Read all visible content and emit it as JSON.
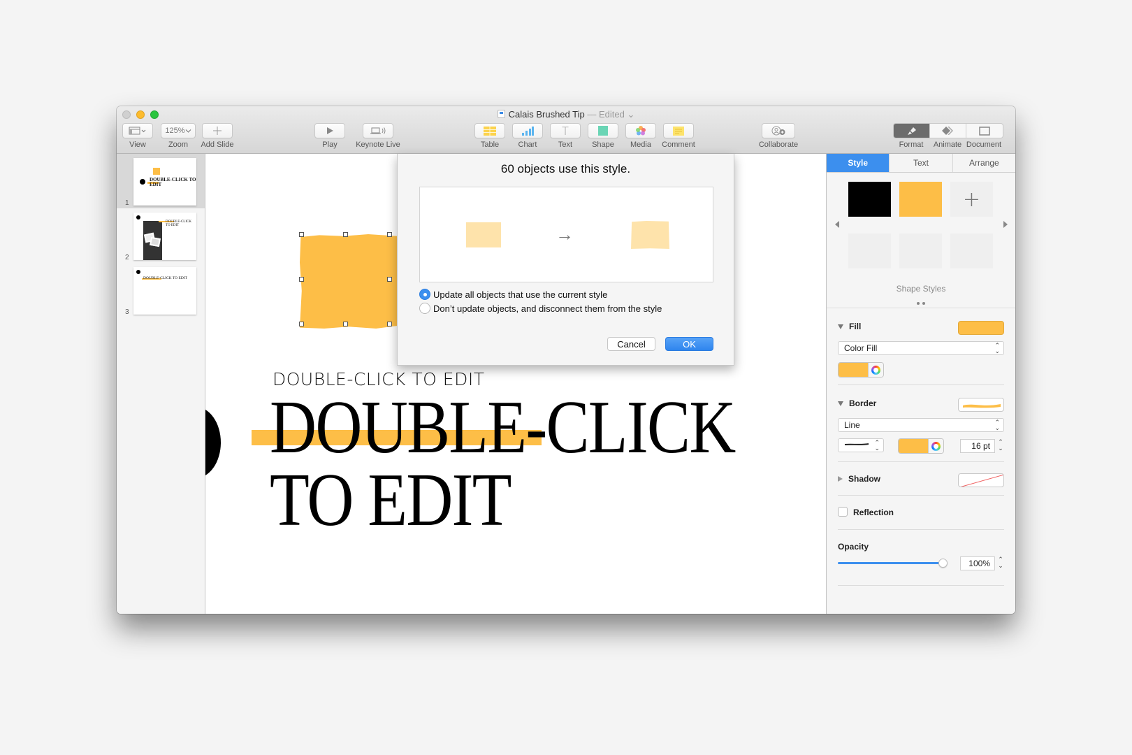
{
  "window": {
    "title": "Calais Brushed Tip",
    "title_separator": " — ",
    "status": "Edited",
    "status_chevron": "⌄"
  },
  "toolbar": {
    "view": {
      "label": "View",
      "icon": "sidebar-layout-icon"
    },
    "zoom": {
      "label": "Zoom",
      "value": "125%"
    },
    "add_slide": {
      "label": "Add Slide",
      "icon": "plus-icon"
    },
    "play": {
      "label": "Play",
      "icon": "play-icon"
    },
    "keynote_live": {
      "label": "Keynote Live",
      "icon": "broadcast-icon"
    },
    "table": {
      "label": "Table",
      "icon": "table-icon"
    },
    "chart": {
      "label": "Chart",
      "icon": "chart-icon"
    },
    "text": {
      "label": "Text",
      "icon": "text-icon",
      "glyph": "T"
    },
    "shape": {
      "label": "Shape",
      "icon": "shape-icon"
    },
    "media": {
      "label": "Media",
      "icon": "photos-icon"
    },
    "comment": {
      "label": "Comment",
      "icon": "comment-icon"
    },
    "collaborate": {
      "label": "Collaborate",
      "icon": "add-person-icon"
    },
    "format": {
      "label": "Format",
      "icon": "paintbrush-icon",
      "active": true
    },
    "animate": {
      "label": "Animate",
      "icon": "diamond-icon"
    },
    "document": {
      "label": "Document",
      "icon": "document-icon"
    }
  },
  "sidebar": {
    "slides": [
      {
        "number": "1",
        "selected": true,
        "heading": "DOUBLE-CLICK TO EDIT"
      },
      {
        "number": "2",
        "selected": false,
        "heading": "DOUBLE-CLICK TO EDIT"
      },
      {
        "number": "3",
        "selected": false,
        "heading": "DOUBLE-CLICK TO EDIT"
      }
    ]
  },
  "canvas": {
    "subtitle": "DOUBLE-CLICK TO EDIT",
    "title_line1": "DOUBLE-CLICK",
    "title_line2": "TO EDIT",
    "accent_color": "#fdbe47"
  },
  "dialog": {
    "title": "60 objects use this style.",
    "arrow": "→",
    "options": [
      {
        "label": "Update all objects that use the current style",
        "selected": true
      },
      {
        "label": "Don’t update objects, and disconnect them from the style",
        "selected": false
      }
    ],
    "cancel_label": "Cancel",
    "ok_label": "OK"
  },
  "inspector": {
    "tabs": [
      {
        "label": "Style",
        "active": true
      },
      {
        "label": "Text",
        "active": false
      },
      {
        "label": "Arrange",
        "active": false
      }
    ],
    "shape_styles_label": "Shape Styles",
    "add_style_glyph": "+",
    "fill": {
      "label": "Fill",
      "type": "Color Fill",
      "color": "#fdbe47"
    },
    "border": {
      "label": "Border",
      "type": "Line",
      "color": "#fdbe47",
      "width": "16 pt"
    },
    "shadow": {
      "label": "Shadow"
    },
    "reflection": {
      "label": "Reflection",
      "checked": false
    },
    "opacity": {
      "label": "Opacity",
      "value": "100%",
      "fraction": 1.0
    }
  }
}
